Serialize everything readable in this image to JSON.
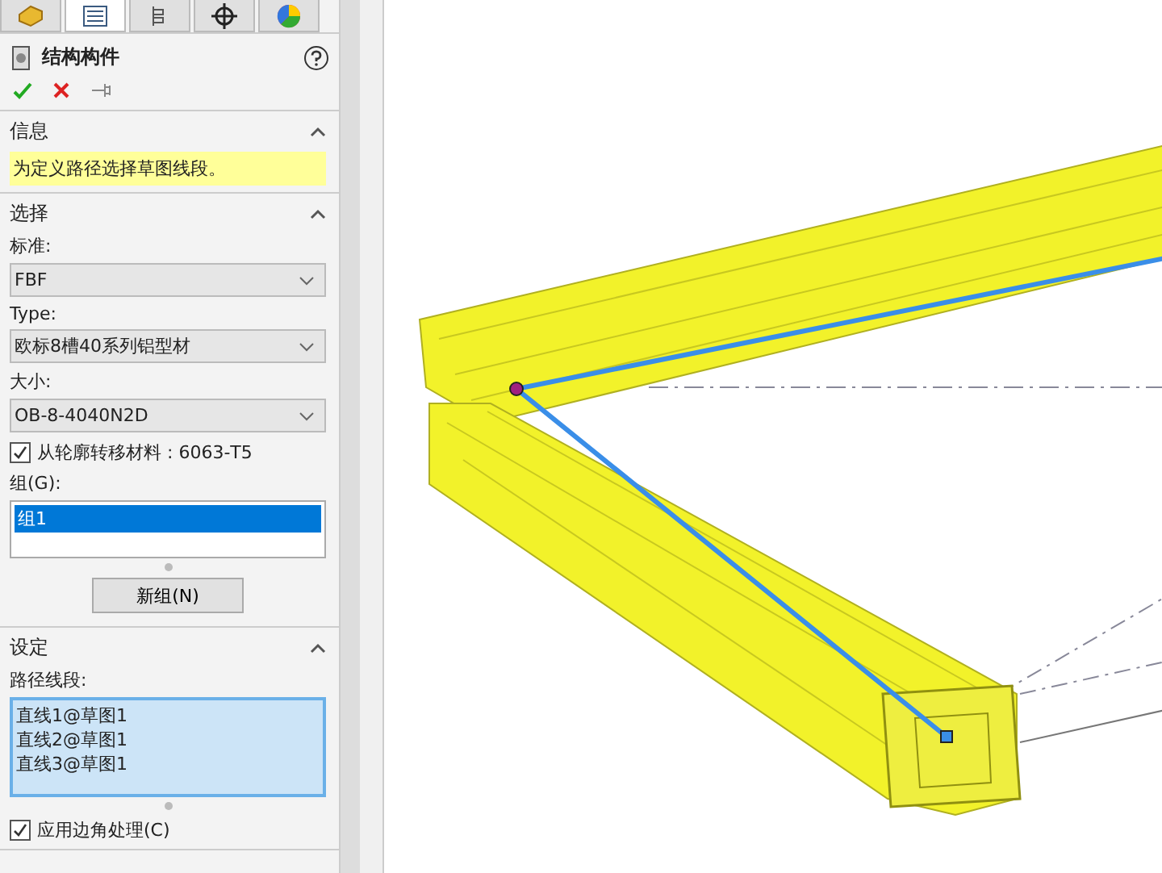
{
  "tabs": [
    {
      "selected": false
    },
    {
      "selected": true
    },
    {
      "selected": false
    },
    {
      "selected": false
    },
    {
      "selected": false
    }
  ],
  "title": "结构构件",
  "message": {
    "title": "信息",
    "text": "为定义路径选择草图线段。",
    "expanded": true
  },
  "selection": {
    "title": "选择",
    "expanded": true,
    "fields": [
      {
        "label": "标准:",
        "value": "FBF"
      },
      {
        "label": "Type:",
        "value": "欧标8槽40系列铝型材"
      },
      {
        "label": "大小:",
        "value": "OB-8-4040N2D"
      }
    ],
    "transfer_material": {
      "label": "从轮廓转移材料 : 6063-T5",
      "checked": true
    },
    "groups_label": "组(G):",
    "groups": [
      {
        "name": "组1",
        "selected": true
      }
    ],
    "new_group_button": "新组(N)"
  },
  "settings": {
    "title": "设定",
    "expanded": true,
    "path_label": "路径线段:",
    "segments": [
      "直线1@草图1",
      "直线2@草图1",
      "直线3@草图1"
    ],
    "corner_treatment": {
      "label": "应用边角处理(C)",
      "checked": true
    }
  }
}
